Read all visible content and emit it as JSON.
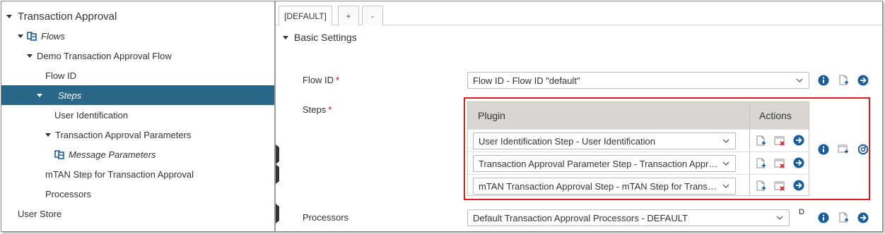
{
  "tree": {
    "items": [
      {
        "label": "Transaction Approval"
      },
      {
        "label": "Flows"
      },
      {
        "label": "Demo Transaction Approval Flow"
      },
      {
        "label": "Flow ID"
      },
      {
        "label": "Steps"
      },
      {
        "label": "User Identification"
      },
      {
        "label": "Transaction Approval Parameters"
      },
      {
        "label": "Message Parameters"
      },
      {
        "label": "mTAN Step for Transaction Approval"
      },
      {
        "label": "Processors"
      },
      {
        "label": "User Store"
      }
    ]
  },
  "tabs": {
    "default_label": "[DEFAULT]",
    "add_label": "+",
    "remove_label": "-"
  },
  "section": {
    "title": "Basic Settings"
  },
  "fields": {
    "flow_id": {
      "label": "Flow ID",
      "required_mark": "*",
      "value": "Flow ID - Flow ID \"default\""
    },
    "steps": {
      "label": "Steps",
      "required_mark": "*",
      "table": {
        "headers": [
          "Plugin",
          "Actions"
        ],
        "rows": [
          {
            "value": "User Identification Step - User Identification"
          },
          {
            "value": "Transaction Approval Parameter Step - Transaction Approval Parameters"
          },
          {
            "value": "mTAN Transaction Approval Step - mTAN Step for Transaction Approval"
          }
        ]
      }
    },
    "processors": {
      "label": "Processors",
      "value": "Default Transaction Approval Processors - DEFAULT",
      "trailing_mark": "D"
    }
  },
  "colors": {
    "selected_row": "#286787",
    "icon_blue": "#1a5d9c",
    "delete_red": "#d42a2a",
    "highlight_border": "#d81e1e",
    "required": "#cc0000"
  }
}
